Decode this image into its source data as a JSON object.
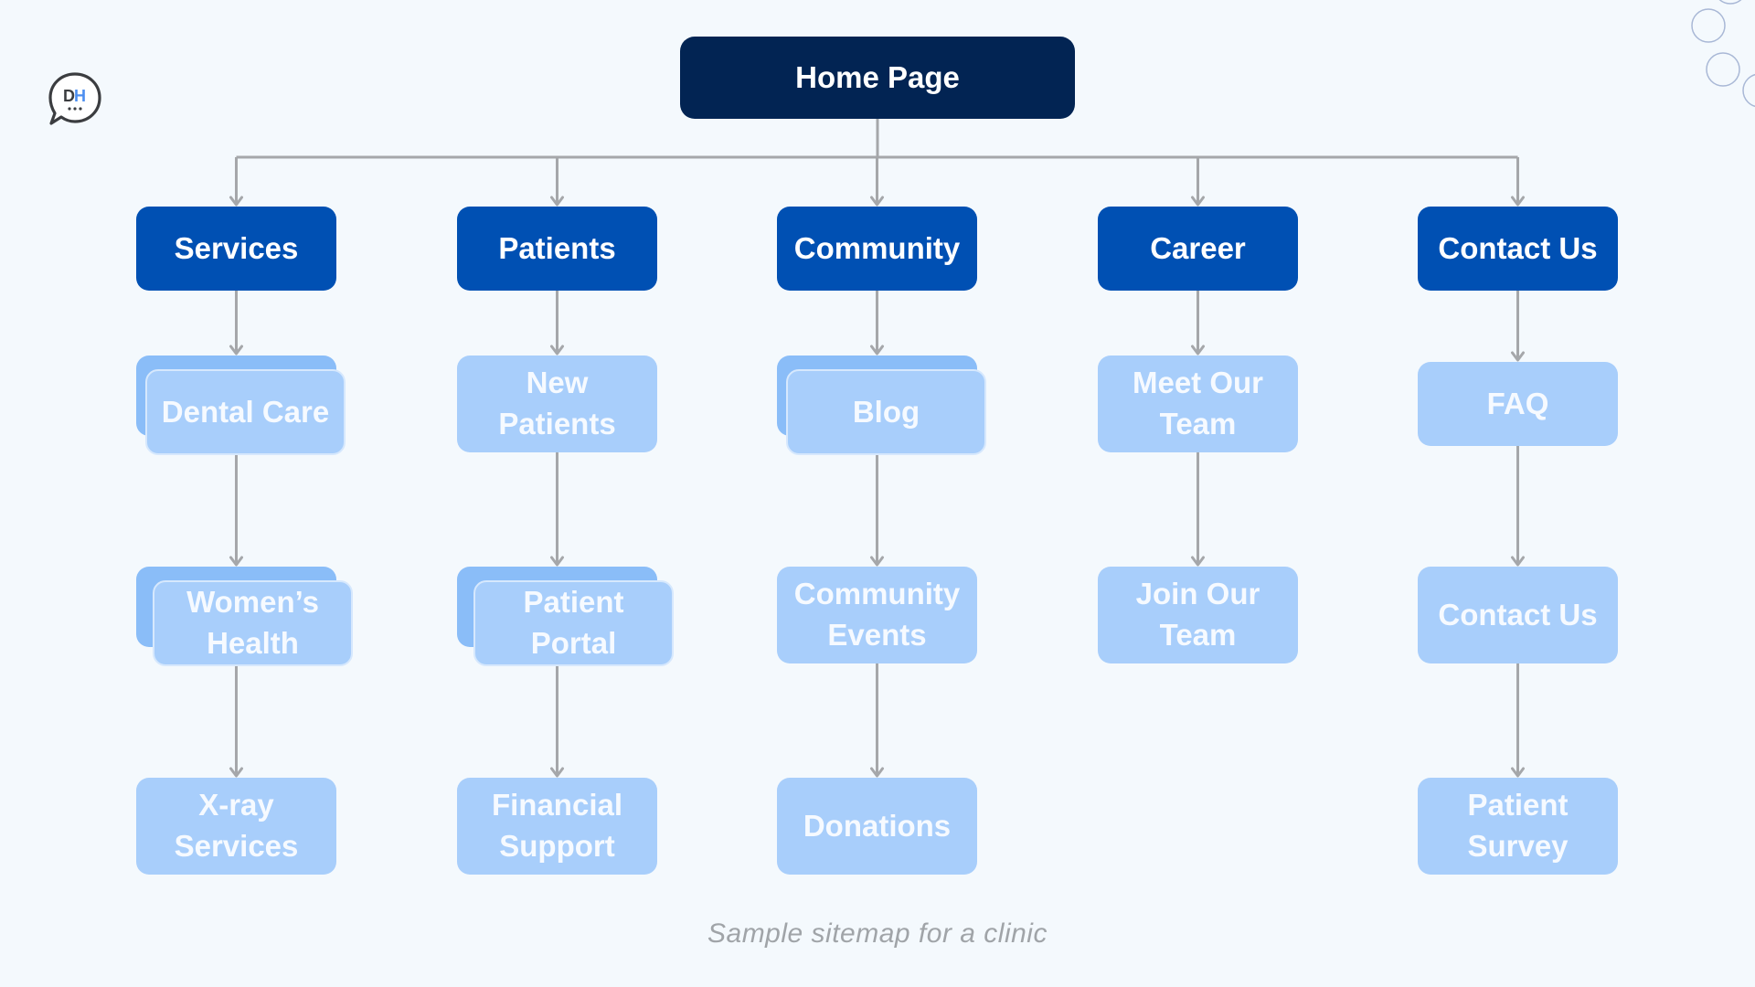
{
  "logo": {
    "letters": [
      "D",
      "H"
    ],
    "colors": {
      "d": "#3b3d40",
      "h": "#4c8ef0",
      "outline": "#3b3d40"
    }
  },
  "colors": {
    "background": "#f4f9fd",
    "root": "#022453",
    "level1": "#0050b3",
    "child": "#a8cefb",
    "child_stack_back": "#8abdf8",
    "connector": "#a5a7aa",
    "caption": "#a0a4a8"
  },
  "sitemap": {
    "root": {
      "label": "Home Page"
    },
    "sections": [
      {
        "label": "Services",
        "children": [
          {
            "lines": [
              "Dental Care"
            ],
            "stacked": true
          },
          {
            "lines": [
              "Women’s",
              "Health"
            ],
            "stacked": true
          },
          {
            "lines": [
              "X-ray",
              "Services"
            ],
            "stacked": false
          }
        ]
      },
      {
        "label": "Patients",
        "children": [
          {
            "lines": [
              "New",
              "Patients"
            ],
            "stacked": false
          },
          {
            "lines": [
              "Patient",
              "Portal"
            ],
            "stacked": true
          },
          {
            "lines": [
              "Financial",
              "Support"
            ],
            "stacked": false
          }
        ]
      },
      {
        "label": "Community",
        "children": [
          {
            "lines": [
              "Blog"
            ],
            "stacked": true
          },
          {
            "lines": [
              "Community",
              "Events"
            ],
            "stacked": false
          },
          {
            "lines": [
              "Donations"
            ],
            "stacked": false
          }
        ]
      },
      {
        "label": "Career",
        "children": [
          {
            "lines": [
              "Meet Our",
              "Team"
            ],
            "stacked": false
          },
          {
            "lines": [
              "Join Our",
              "Team"
            ],
            "stacked": false
          }
        ]
      },
      {
        "label": "Contact Us",
        "children": [
          {
            "lines": [
              "FAQ"
            ],
            "stacked": false
          },
          {
            "lines": [
              "Contact Us"
            ],
            "stacked": false
          },
          {
            "lines": [
              "Patient",
              "Survey"
            ],
            "stacked": false
          }
        ]
      }
    ]
  },
  "caption": "Sample sitemap for a clinic"
}
